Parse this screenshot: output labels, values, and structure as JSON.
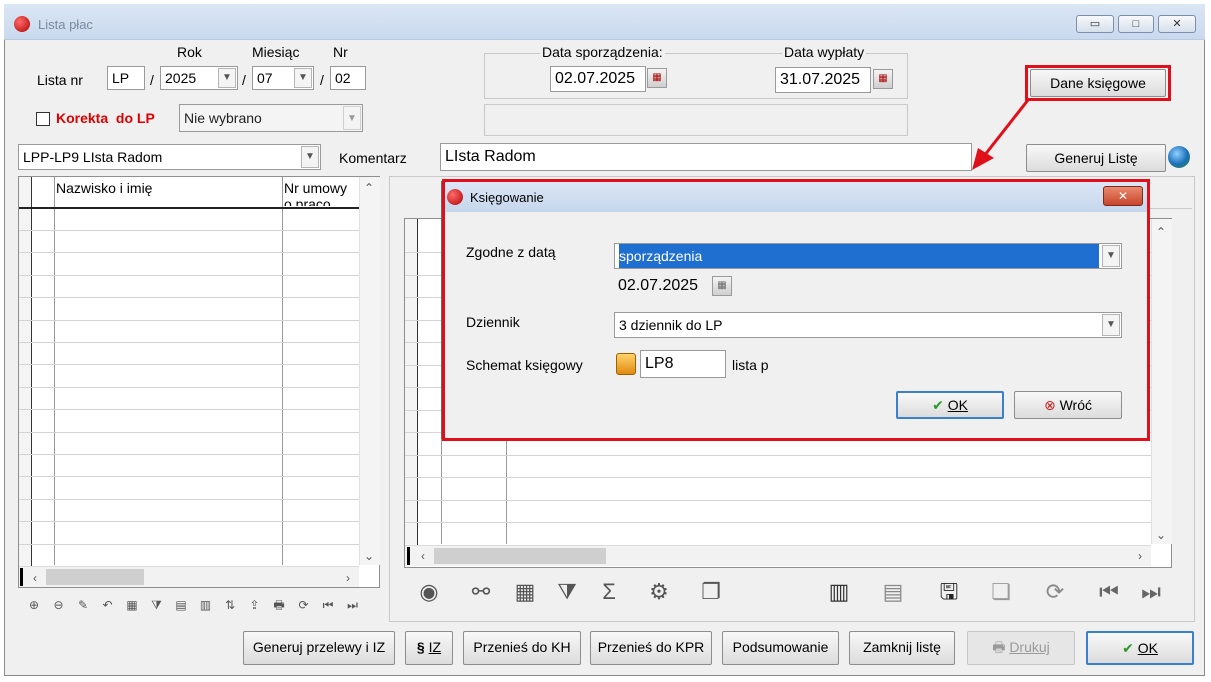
{
  "window": {
    "title": "Lista płac"
  },
  "header": {
    "lista_nr_label": "Lista nr",
    "rok_label": "Rok",
    "miesiac_label": "Miesiąc",
    "nr_label": "Nr",
    "prefix": "LP",
    "sep1": "/",
    "sep2": "/",
    "sep3": "/",
    "year": "2025",
    "month": "07",
    "nr": "02",
    "korekta_label_1": "Korekta",
    "korekta_label_2": "do LP",
    "korekta_select": "Nie wybrano",
    "data_sporzadzenia_label": "Data sporządzenia:",
    "data_sporzadzenia": "02.07.2025",
    "data_wyplaty_label": "Data wypłaty",
    "data_wyplaty": "31.07.2025",
    "dane_ksiegowe_button": "Dane księgowe",
    "typ_select": "LPP-LP9 LIsta Radom",
    "komentarz_label": "Komentarz",
    "komentarz_value": "LIsta Radom",
    "generuj_liste_button": "Generuj Listę"
  },
  "left_grid": {
    "col_name": "Nazwisko i imię",
    "col_contract": "Nr umowy o praco"
  },
  "dialog": {
    "title": "Księgowanie",
    "close_label": "✕",
    "zgodne_label": "Zgodne z datą",
    "zgodne_value": "sporządzenia",
    "date_value": "02.07.2025",
    "dziennik_label": "Dziennik",
    "dziennik_value": "3  dziennik do LP",
    "schemat_label": "Schemat księgowy",
    "schemat_code": "LP8",
    "schemat_desc": "lista p",
    "ok_label": "OK",
    "wroc_label": "Wróć"
  },
  "bottom": {
    "generuj_przelewy": "Generuj przelewy i IZ",
    "iz": "IZ",
    "przenies_kh": "Przenieś do KH",
    "przenies_kpr": "Przenieś do KPR",
    "podsumowanie": "Podsumowanie",
    "zamknij": "Zamknij listę",
    "drukuj": "Drukuj",
    "ok": "OK"
  }
}
